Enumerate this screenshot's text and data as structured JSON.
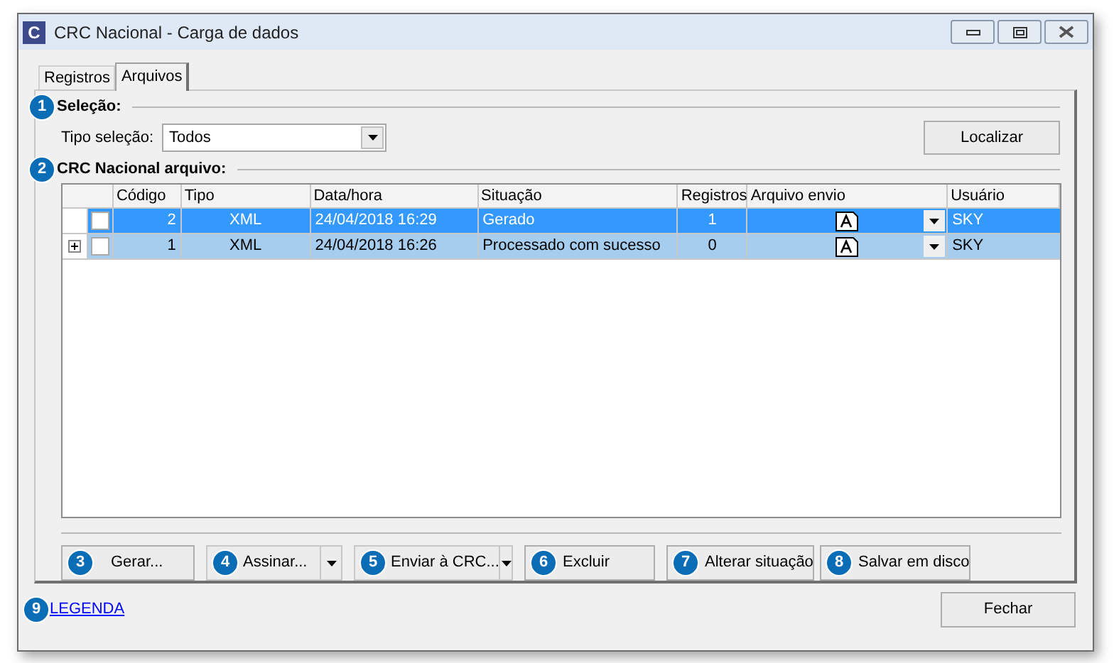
{
  "window": {
    "title": "CRC Nacional - Carga de dados",
    "app_icon": "C"
  },
  "tabs": [
    {
      "label": "Registros",
      "selected": false
    },
    {
      "label": "Arquivos",
      "selected": true
    }
  ],
  "selection": {
    "heading": "Seleção:",
    "callout": "1",
    "type_label": "Tipo seleção:",
    "type_value": "Todos",
    "find_button": "Localizar"
  },
  "files": {
    "heading": "CRC Nacional arquivo:",
    "callout": "2",
    "columns": [
      "Código",
      "Tipo",
      "Data/hora",
      "Situação",
      "Registros",
      "Arquivo envio",
      "Usuário"
    ],
    "rows": [
      {
        "selected": true,
        "focused": true,
        "expandable": false,
        "checked": false,
        "cells": [
          "2",
          "XML",
          "24/04/2018 16:29",
          "Gerado",
          "1",
          "SKY"
        ]
      },
      {
        "selected": true,
        "focused": false,
        "expandable": true,
        "checked": false,
        "cells": [
          "1",
          "XML",
          "24/04/2018 16:26",
          "Processado com sucesso",
          "0",
          "SKY"
        ]
      }
    ]
  },
  "actions": [
    {
      "label": "Gerar...",
      "callout": "3",
      "kind": "plain"
    },
    {
      "label": "Assinar...",
      "callout": "4",
      "kind": "split"
    },
    {
      "label": "Enviar à CRC...",
      "callout": "5",
      "kind": "split"
    },
    {
      "label": "Excluir",
      "callout": "6",
      "kind": "plain"
    },
    {
      "label": "Alterar situação",
      "callout": "7",
      "kind": "plain"
    },
    {
      "label": "Salvar em disco",
      "callout": "8",
      "kind": "plain"
    }
  ],
  "legend_link": {
    "label": "LEGENDA",
    "callout": "9"
  },
  "close_button": "Fechar"
}
